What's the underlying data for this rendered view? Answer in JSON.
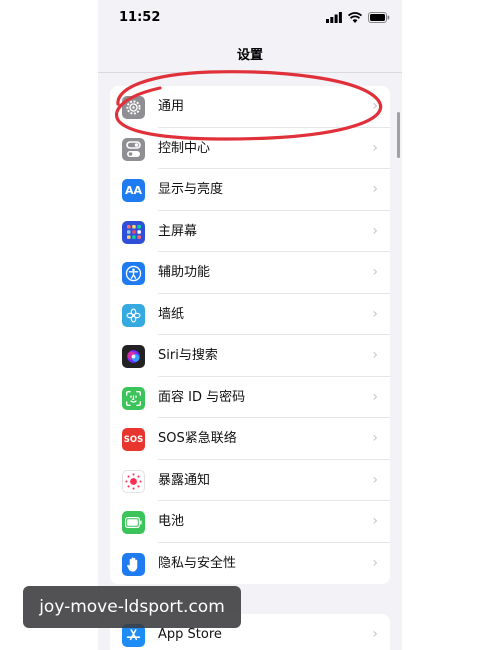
{
  "status_bar": {
    "time": "11:52"
  },
  "nav": {
    "title": "设置"
  },
  "settings_items": [
    {
      "label": "通用",
      "icon": "gear-icon",
      "color": "#8e8e93"
    },
    {
      "label": "控制中心",
      "icon": "control-center-icon",
      "color": "#8e8e93"
    },
    {
      "label": "显示与亮度",
      "icon": "display-brightness-icon",
      "color": "#1e7cf0",
      "glyph": "AA"
    },
    {
      "label": "主屏幕",
      "icon": "home-screen-icon",
      "color": "#2f4fd8"
    },
    {
      "label": "辅助功能",
      "icon": "accessibility-icon",
      "color": "#1e7cf0"
    },
    {
      "label": "墙纸",
      "icon": "wallpaper-icon",
      "color": "#35a9e0"
    },
    {
      "label": "Siri与搜索",
      "icon": "siri-icon",
      "color": "#222222"
    },
    {
      "label": "面容 ID 与密码",
      "icon": "face-id-icon",
      "color": "#3bc45a"
    },
    {
      "label": "SOS紧急联络",
      "icon": "sos-icon",
      "color": "#e8352e",
      "glyph": "SOS"
    },
    {
      "label": "暴露通知",
      "icon": "exposure-notification-icon",
      "color": "#ffffff"
    },
    {
      "label": "电池",
      "icon": "battery-icon",
      "color": "#3bc45a"
    },
    {
      "label": "隐私与安全性",
      "icon": "privacy-hand-icon",
      "color": "#1e7cf0"
    }
  ],
  "store_item": {
    "label": "App Store",
    "icon": "app-store-icon",
    "color": "#1e8cf5"
  },
  "chevron_glyph": "›",
  "annotation": {
    "color": "#e0303a"
  },
  "watermark": {
    "text": "joy-move-ldsport.com"
  }
}
